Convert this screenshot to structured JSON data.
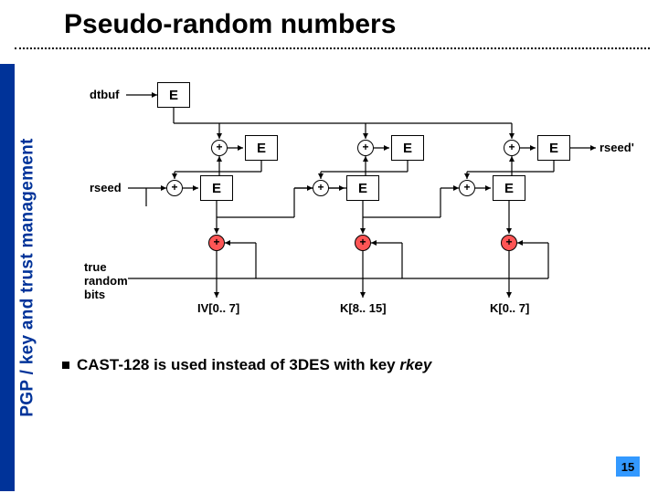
{
  "title": "Pseudo-random numbers",
  "sidebar": "PGP / key and trust management",
  "labels": {
    "dtbuf": "dtbuf",
    "rseed": "rseed",
    "rseed_prime": "rseed'",
    "true_random_bits": "true\nrandom\nbits",
    "iv": "IV[0.. 7]",
    "k1": "K[8.. 15]",
    "k2": "K[0.. 7]"
  },
  "ebox_label": "E",
  "xor_label": "+",
  "bullet": {
    "prefix": "CAST-128 is used instead of 3DES with key ",
    "italic": "rkey"
  },
  "page_number": "15"
}
